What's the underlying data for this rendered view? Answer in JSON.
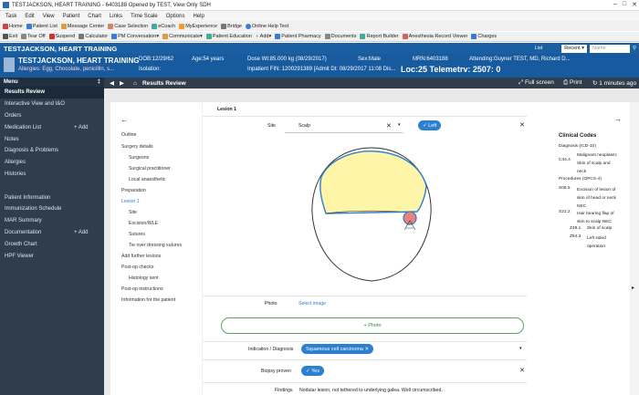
{
  "window": {
    "title": "TESTJACKSON, HEART TRAINING - 6403188 Opened by TEST, View Only SDH"
  },
  "menu": [
    "Task",
    "Edit",
    "View",
    "Patient",
    "Chart",
    "Links",
    "Time Scale",
    "Options",
    "Help"
  ],
  "toolbar1": [
    "Home",
    "Patient List",
    "Message Center",
    "Case Selection",
    "eCoach",
    "MyExperience",
    "Bridge",
    "Online Help Text"
  ],
  "toolbar2": [
    "Exit",
    "Tear Off",
    "Suspend",
    "Calculator",
    "PM Conversation",
    "Communicate",
    "Patient Education",
    "Add",
    "Patient Pharmacy",
    "Documents",
    "Report Builder",
    "Anesthesia Record Viewer",
    "Charges"
  ],
  "patient_title": "TESTJACKSON, HEART TRAINING",
  "title_right": {
    "list": "List",
    "recent": "Recent",
    "name_placeholder": "Name"
  },
  "banner": {
    "name": "TESTJACKSON, HEART TRAINING",
    "allergies": "Allergies: Egg, Chocolate, penicillin, s...",
    "isolation": "Isolation:",
    "dob": "DOB:12/29/62",
    "age": "Age:54 years",
    "dose_wt": "Dose Wt:85.000 kg (08/29/2017)",
    "sex": "Sex:Male",
    "mrn": "MRN:6403188",
    "attending": "Attending:Guyner TEST, MD, Richard D...",
    "fin": "Inpatient FIN: 1200291389 [Admit Dt: 08/29/2017 11:08 Dis...",
    "loc": "Loc:25 Telemetrv: 2507: 0"
  },
  "sidebar": {
    "header": "Menu",
    "items": [
      {
        "label": "Results Review",
        "add": "",
        "active": true
      },
      {
        "label": "Interactive View and I&O",
        "add": ""
      },
      {
        "label": "Orders",
        "add": ""
      },
      {
        "label": "Medication List",
        "add": "Add"
      },
      {
        "label": "Notes",
        "add": ""
      },
      {
        "label": "Diagnosis & Problems",
        "add": ""
      },
      {
        "label": "Allergies",
        "add": ""
      },
      {
        "label": "Histories",
        "add": ""
      },
      {
        "label": "",
        "add": ""
      },
      {
        "label": "Patient Information",
        "add": ""
      },
      {
        "label": "Immunization Schedule",
        "add": ""
      },
      {
        "label": "MAR Summary",
        "add": ""
      },
      {
        "label": "Documentation",
        "add": "Add"
      },
      {
        "label": "Growth Chart",
        "add": ""
      },
      {
        "label": "HPF Viewer",
        "add": ""
      }
    ]
  },
  "main_header": {
    "title": "Results Review",
    "full_screen": "Full screen",
    "print": "Print",
    "updated": "1 minutes ago"
  },
  "left_nav": [
    "Outline",
    "Surgery details",
    "Surgeons",
    "Surgical practitioner",
    "Local anaesthetic",
    "Preparation",
    "Lesion 1",
    "Site",
    "Excision/WLE",
    "Sutures",
    "Tie over dressing sutures",
    "Add further lesions",
    "Post-op checks",
    "Histology sent",
    "Post-op instructions",
    "Information for the patient"
  ],
  "form": {
    "section": "Lesion 1",
    "site_label": "Site",
    "site_value": "Scalp",
    "side_value": "Left",
    "photo_label": "Photo",
    "select_image": "Select image",
    "photo_button": "Photo",
    "indication_label": "Indication / Diagnosis",
    "indication_value": "Squamous cell carcinoma",
    "biopsy_label": "Biopsy proven",
    "biopsy_value": "Yes",
    "findings_label": "Findings",
    "findings_value": "Nodular lesion, not tethered to underlying galea. Well circumscribed."
  },
  "clinical_codes": {
    "title": "Clinical Codes",
    "diag_header": "Diagnosis (ICD-10)",
    "diag_code": "C44.4",
    "diag_text": "Malignant neoplasm: Skin of scalp and neck",
    "proc_header": "Procedures (OPCS-4)",
    "procedures": [
      {
        "code": "S06.5",
        "text": "Excision of lesion of skin of head or neck NEC"
      },
      {
        "code": "S21.2",
        "text": "Hair bearing flap of skin to scalp NEC"
      },
      {
        "code": "Z48.1",
        "text": "Skin of scalp"
      },
      {
        "code": "Z94.3",
        "text": "Left sided operation"
      }
    ]
  },
  "colors": {
    "banner": "#175a9e",
    "sidebar": "#2f3d4c",
    "accent": "#2d7fd0",
    "highlight": "#fff5a8",
    "lesion": "#e8827a"
  }
}
